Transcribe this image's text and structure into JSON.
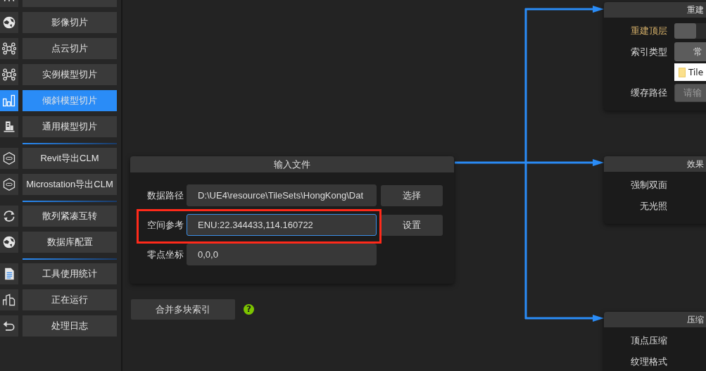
{
  "sidebar": {
    "groups": [
      {
        "items": [
          {
            "kind": "tower",
            "selected": false
          },
          {
            "kind": "globe",
            "label": "影像切片",
            "selected": false
          },
          {
            "kind": "network",
            "label": "点云切片",
            "selected": false
          },
          {
            "kind": "network",
            "label": "实例模型切片",
            "selected": false
          },
          {
            "kind": "chart",
            "label": "倾斜模型切片",
            "selected": true
          },
          {
            "kind": "building",
            "label": "通用模型切片",
            "selected": false
          }
        ]
      },
      {
        "items": [
          {
            "kind": "lod",
            "label": "Revit导出CLM",
            "selected": false
          },
          {
            "kind": "lod",
            "label": "Microstation导出CLM",
            "selected": false
          }
        ]
      },
      {
        "items": [
          {
            "kind": "sync",
            "label": "散列紧凑互转",
            "selected": false
          },
          {
            "kind": "globe",
            "label": "数据库配置",
            "selected": false
          }
        ]
      },
      {
        "items": [
          {
            "kind": "doc",
            "label": "工具使用统计",
            "selected": false
          },
          {
            "kind": "city",
            "label": "正在运行",
            "selected": false
          },
          {
            "kind": "undo",
            "label": "处理日志",
            "selected": false
          }
        ]
      }
    ]
  },
  "input_panel": {
    "title": "输入文件",
    "rows": [
      {
        "label": "数据路径",
        "value": "D:\\UE4\\resource\\TileSets\\HongKong\\Dat",
        "button": "选择",
        "focused": false,
        "highlighted": false
      },
      {
        "label": "空间参考",
        "value": "ENU:22.344433,114.160722",
        "button": "设置",
        "focused": true,
        "highlighted": true
      },
      {
        "label": "零点坐标",
        "value": "0,0,0",
        "focused": false,
        "highlighted": false
      }
    ]
  },
  "merge_button": {
    "label": "合并多块索引",
    "help": "?"
  },
  "nodes": [
    {
      "title": "重建",
      "rows": [
        {
          "kind": "toggle",
          "label": "重建顶层",
          "accent": true,
          "on": false
        },
        {
          "kind": "select",
          "label": "索引类型",
          "accent": false,
          "value": "常"
        },
        {
          "kind": "list",
          "items": [
            "Tile"
          ]
        },
        {
          "kind": "field",
          "label": "缓存路径",
          "accent": false,
          "placeholder": "请输"
        }
      ]
    },
    {
      "title": "效果",
      "rows": [
        {
          "kind": "label",
          "label": "强制双面",
          "accent": false
        },
        {
          "kind": "label",
          "label": "无光照",
          "accent": false
        }
      ]
    },
    {
      "title": "压缩",
      "rows": [
        {
          "kind": "label",
          "label": "顶点压缩",
          "accent": false
        },
        {
          "kind": "label",
          "label": "纹理格式",
          "accent": false
        }
      ]
    }
  ]
}
